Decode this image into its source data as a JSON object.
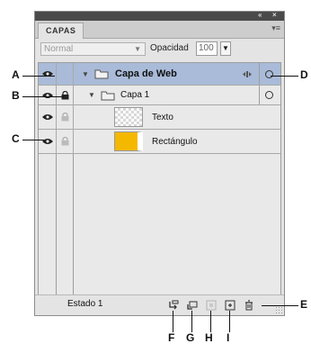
{
  "panel": {
    "collapse_glyph": "«",
    "close_glyph": "×",
    "tab_label": "CAPAS",
    "menu_glyph": "▾≡",
    "blend_mode": "Normal",
    "opacity_label": "Opacidad",
    "opacity_value": "100",
    "dropdown_glyph": "▼"
  },
  "layers": [
    {
      "name": "Capa de Web",
      "level": 0,
      "expanded": true,
      "selected": true,
      "visible": true,
      "locked": false,
      "type": "folder"
    },
    {
      "name": "Capa 1",
      "level": 1,
      "expanded": true,
      "selected": false,
      "visible": true,
      "locked": true,
      "type": "folder"
    },
    {
      "name": "Texto",
      "level": 2,
      "selected": false,
      "visible": true,
      "locked": false,
      "type": "text"
    },
    {
      "name": "Rectángulo",
      "level": 2,
      "selected": false,
      "visible": true,
      "locked": false,
      "type": "rectangle"
    }
  ],
  "bottom": {
    "state_label": "Estado 1",
    "icons": [
      "new-sublayer-icon",
      "new-layer-icon",
      "animate-icon",
      "add-to-library-icon",
      "delete-icon"
    ]
  },
  "callouts": {
    "A": "A",
    "B": "B",
    "C": "C",
    "D": "D",
    "E": "E",
    "F": "F",
    "G": "G",
    "H": "H",
    "I": "I"
  },
  "colors": {
    "selection": "#a9bbd8",
    "rect_thumb": "#f5b800",
    "titlebar": "#4a4a4a"
  }
}
